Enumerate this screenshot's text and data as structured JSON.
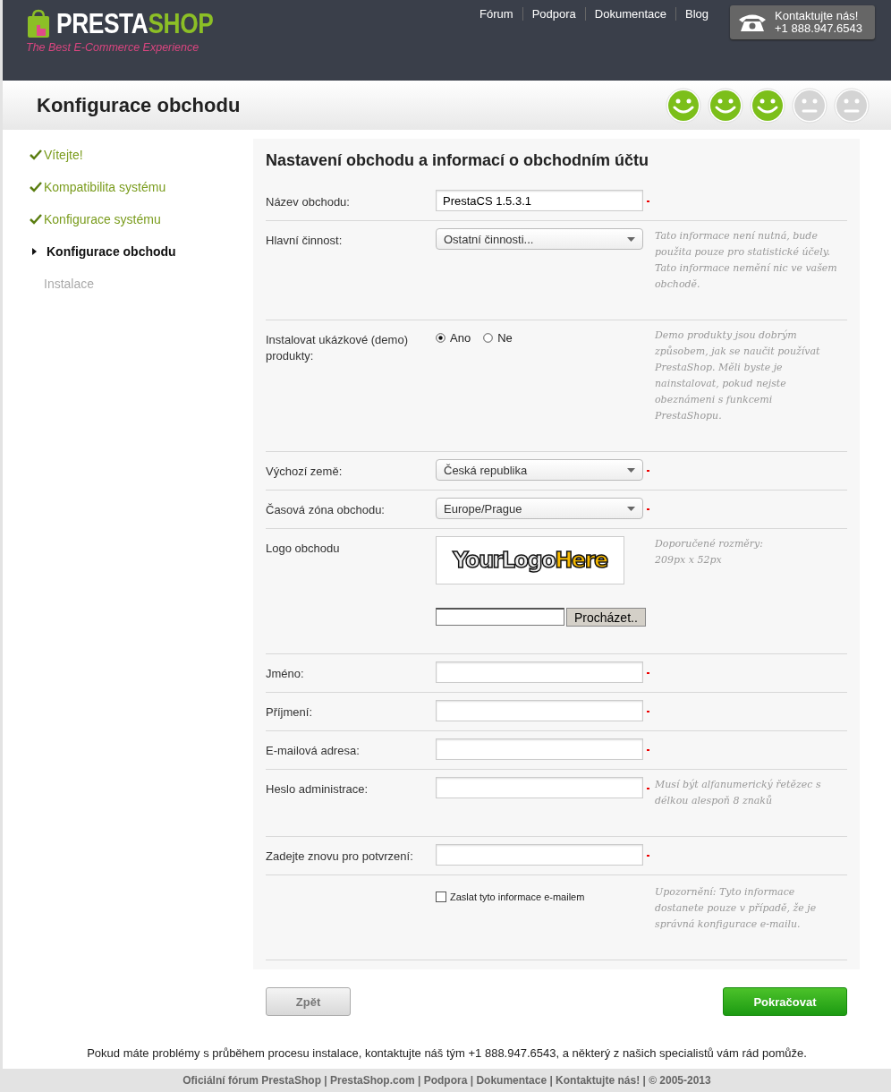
{
  "header": {
    "brand": {
      "name_1": "PRESTA",
      "name_2": "SHOP",
      "tagline": "The Best E-Commerce Experience"
    },
    "nav": [
      "Fórum",
      "Podpora",
      "Dokumentace",
      "Blog"
    ],
    "contact": {
      "title": "Kontaktujte nás!",
      "phone": "+1 888.947.6543"
    }
  },
  "title_bar": {
    "title": "Konfigurace obchodu",
    "progress": [
      {
        "happy": true
      },
      {
        "happy": true
      },
      {
        "happy": true
      },
      {
        "happy": false
      },
      {
        "happy": false
      }
    ]
  },
  "steps": [
    {
      "label": "Vítejte!",
      "done": true,
      "selected": false
    },
    {
      "label": "Kompatibilita systému",
      "done": true,
      "selected": false
    },
    {
      "label": "Konfigurace systému",
      "done": true,
      "selected": false
    },
    {
      "label": "Konfigurace obchodu",
      "done": false,
      "selected": true
    },
    {
      "label": "Instalace",
      "done": false,
      "selected": false
    }
  ],
  "form": {
    "title": "Nastavení obchodu a informací o obchodním účtu",
    "rows": [
      {
        "kind": "text",
        "label": "Název obchodu:",
        "value": "PrestaCS 1.5.3.1",
        "required": true
      },
      {
        "kind": "select",
        "label": "Hlavní činnost:",
        "value": "Ostatní činnosti...",
        "required": false,
        "help": "Tato informace není nutná, bude použita pouze pro statistické účely. Tato informace nemění nic ve vašem obchodě."
      },
      {
        "kind": "radio",
        "label": "Instalovat ukázkové (demo) produkty:",
        "required": false,
        "options": [
          {
            "label": "Ano",
            "selected": true
          },
          {
            "label": "Ne",
            "selected": false
          }
        ],
        "help": "Demo produkty jsou dobrým způsobem, jak se naučit používat PrestaShop. Měli byste je nainstalovat, pokud nejste obeznámeni s funkcemi PrestaShopu."
      },
      {
        "kind": "select",
        "label": "Výchozí země:",
        "value": "Česká republika",
        "required": true
      },
      {
        "kind": "select",
        "label": "Časová zóna obchodu:",
        "value": "Europe/Prague",
        "required": true
      },
      {
        "kind": "logo",
        "label": "Logo obchodu",
        "required": false,
        "logo_text_1": "YourLogo",
        "logo_text_2": "Here",
        "browse": "Procházet..",
        "help": "Doporučené rozměry:\n209px x 52px"
      },
      {
        "kind": "text",
        "label": "Jméno:",
        "value": "",
        "required": true
      },
      {
        "kind": "text",
        "label": "Příjmení:",
        "value": "",
        "required": true
      },
      {
        "kind": "text",
        "label": "E-mailová adresa:",
        "value": "",
        "required": true
      },
      {
        "kind": "text",
        "label": "Heslo administrace:",
        "value": "",
        "required": true,
        "help": "Musí být alfanumerický řetězec s délkou alespoň 8 znaků"
      },
      {
        "kind": "text",
        "label": "Zadejte znovu pro potvrzení:",
        "value": "",
        "required": true
      },
      {
        "kind": "checkbox",
        "checkbox_label": "Zaslat tyto informace e-mailem",
        "checked": false,
        "required": false,
        "help": "Upozornění: Tyto informace dostanete pouze v případě, že je správná konfigurace e-mailu."
      }
    ]
  },
  "buttons": {
    "back": "Zpět",
    "next": "Pokračovat"
  },
  "help_text": "Pokud máte problémy s průběhem procesu instalace, kontaktujte náš tým +1 888.947.6543, a některý z našich specialistů vám rád pomůže.",
  "footer": "Oficiální fórum PrestaShop | PrestaShop.com | Podpora | Dokumentace | Kontaktujte nás! | © 2005-2013"
}
